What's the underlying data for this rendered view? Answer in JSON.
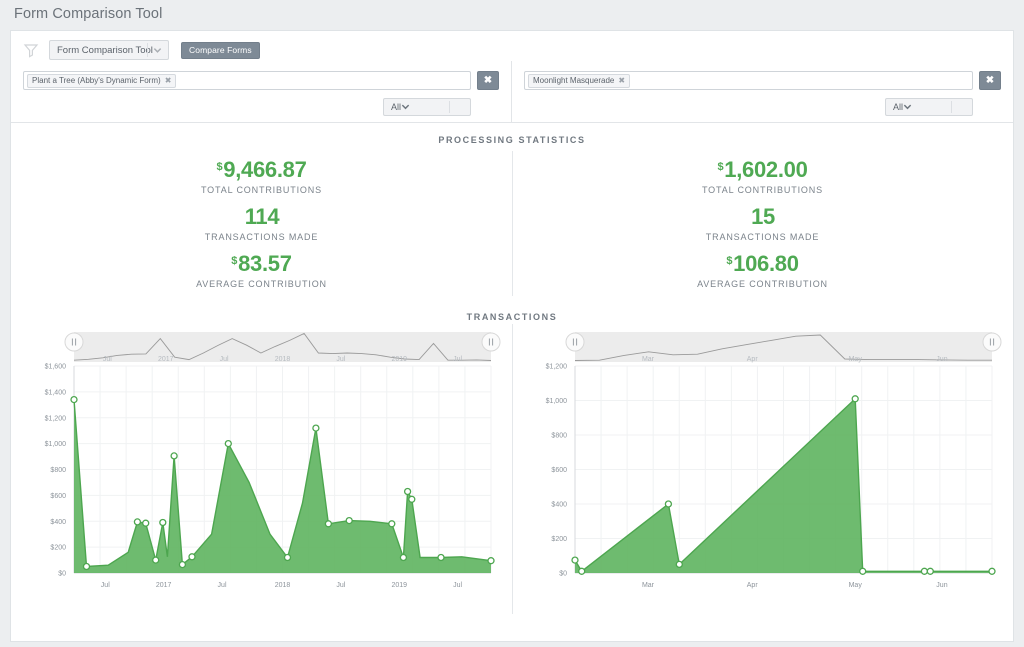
{
  "page": {
    "title": "Form Comparison Tool"
  },
  "toolbar": {
    "filter_icon": "funnel-icon",
    "report_select": {
      "value": "Form Comparison Tool",
      "caret_icon": "chevron-down-icon"
    },
    "compare_button": "Compare Forms"
  },
  "panes": [
    {
      "side": "left",
      "tag": "Plant a Tree (Abby's Dynamic Form)",
      "tag_remove_icon": "close-x-icon",
      "clear_label": "✖",
      "scope": {
        "value": "All",
        "caret_icon": "chevron-down-icon"
      }
    },
    {
      "side": "right",
      "tag": "Moonlight Masquerade",
      "tag_remove_icon": "close-x-icon",
      "clear_label": "✖",
      "scope": {
        "value": "All",
        "caret_icon": "chevron-down-icon"
      }
    }
  ],
  "sections": {
    "processing_statistics": "PROCESSING STATISTICS",
    "transactions": "TRANSACTIONS"
  },
  "stats": {
    "accent_color": "#4fa953",
    "left": [
      {
        "currency": "$",
        "value": "9,466.87",
        "label": "TOTAL CONTRIBUTIONS"
      },
      {
        "currency": "",
        "value": "114",
        "label": "TRANSACTIONS MADE"
      },
      {
        "currency": "$",
        "value": "83.57",
        "label": "AVERAGE CONTRIBUTION"
      }
    ],
    "right": [
      {
        "currency": "$",
        "value": "1,602.00",
        "label": "TOTAL CONTRIBUTIONS"
      },
      {
        "currency": "",
        "value": "15",
        "label": "TRANSACTIONS MADE"
      },
      {
        "currency": "$",
        "value": "106.80",
        "label": "AVERAGE CONTRIBUTION"
      }
    ]
  },
  "chart_data": [
    {
      "id": "left-transactions-chart",
      "type": "area",
      "title": "TRANSACTIONS",
      "xlabel": "",
      "ylabel": "",
      "series_color": "#62b563",
      "grid": true,
      "legend": "none",
      "ylim": [
        0,
        1600
      ],
      "yticks": [
        0,
        200,
        400,
        600,
        800,
        1000,
        1200,
        1400,
        1600
      ],
      "ytick_labels": [
        "$0",
        "$200",
        "$400",
        "$600",
        "$800",
        "$1,000",
        "$1,200",
        "$1,400",
        "$1,600"
      ],
      "xtick_labels": [
        "Jul",
        "2017",
        "Jul",
        "2018",
        "Jul",
        "2019",
        "Jul"
      ],
      "xtick_positions": [
        0.075,
        0.215,
        0.355,
        0.5,
        0.64,
        0.78,
        0.92
      ],
      "x": [
        0.0,
        0.03,
        0.082,
        0.13,
        0.152,
        0.172,
        0.196,
        0.213,
        0.224,
        0.24,
        0.26,
        0.283,
        0.33,
        0.37,
        0.42,
        0.47,
        0.512,
        0.548,
        0.58,
        0.61,
        0.66,
        0.71,
        0.762,
        0.79,
        0.8,
        0.81,
        0.83,
        0.88,
        0.93,
        1.0
      ],
      "values": [
        1340,
        50,
        60,
        160,
        395,
        385,
        100,
        390,
        125,
        905,
        65,
        125,
        300,
        1000,
        700,
        300,
        120,
        540,
        1120,
        380,
        405,
        400,
        380,
        120,
        630,
        570,
        120,
        120,
        125,
        95
      ],
      "markers_x": [
        0.0,
        0.03,
        0.152,
        0.172,
        0.196,
        0.213,
        0.24,
        0.26,
        0.283,
        0.37,
        0.512,
        0.58,
        0.61,
        0.66,
        0.762,
        0.79,
        0.8,
        0.81,
        0.88,
        1.0
      ],
      "markers_y": [
        1340,
        50,
        395,
        385,
        100,
        390,
        905,
        65,
        125,
        1000,
        120,
        1120,
        380,
        405,
        380,
        120,
        630,
        570,
        120,
        95
      ],
      "navigator": {
        "visible": true,
        "labels": [
          "Jul",
          "2017",
          "Jul",
          "2018",
          "Jul",
          "2019",
          "Jul"
        ],
        "label_positions": [
          0.08,
          0.22,
          0.36,
          0.5,
          0.64,
          0.78,
          0.92
        ],
        "cumulative": [
          0.06,
          0.09,
          0.14,
          0.22,
          0.26,
          0.27,
          0.78,
          0.16,
          0.08,
          0.3,
          0.55,
          0.78,
          0.56,
          0.3,
          0.52,
          0.72,
          0.95,
          0.3,
          0.28,
          0.3,
          0.28,
          0.24,
          0.16,
          0.1,
          0.08,
          0.62,
          0.06,
          0.06,
          0.07,
          0.05
        ]
      }
    },
    {
      "id": "right-transactions-chart",
      "type": "area",
      "title": "TRANSACTIONS",
      "xlabel": "",
      "ylabel": "",
      "series_color": "#62b563",
      "grid": true,
      "legend": "none",
      "ylim": [
        0,
        1200
      ],
      "yticks": [
        0,
        200,
        400,
        600,
        800,
        1000,
        1200
      ],
      "ytick_labels": [
        "$0",
        "$200",
        "$400",
        "$600",
        "$800",
        "$1,000",
        "$1,200"
      ],
      "xtick_labels": [
        "Mar",
        "Apr",
        "May",
        "Jun"
      ],
      "xtick_positions": [
        0.175,
        0.425,
        0.672,
        0.88
      ],
      "x": [
        0.0,
        0.016,
        0.224,
        0.25,
        0.672,
        0.69,
        0.838,
        0.852,
        1.0
      ],
      "values": [
        75,
        10,
        400,
        50,
        1010,
        10,
        10,
        10,
        10
      ],
      "markers_x": [
        0.0,
        0.016,
        0.224,
        0.25,
        0.672,
        0.69,
        0.838,
        0.852,
        1.0
      ],
      "markers_y": [
        75,
        10,
        400,
        50,
        1010,
        10,
        10,
        10,
        10
      ],
      "navigator": {
        "visible": true,
        "labels": [
          "Mar",
          "Apr",
          "May",
          "Jun"
        ],
        "label_positions": [
          0.175,
          0.425,
          0.672,
          0.88
        ],
        "cumulative": [
          0.05,
          0.06,
          0.22,
          0.34,
          0.24,
          0.26,
          0.44,
          0.58,
          0.72,
          0.86,
          0.9,
          0.1,
          0.08,
          0.08,
          0.08,
          0.07,
          0.06,
          0.06
        ]
      }
    }
  ]
}
